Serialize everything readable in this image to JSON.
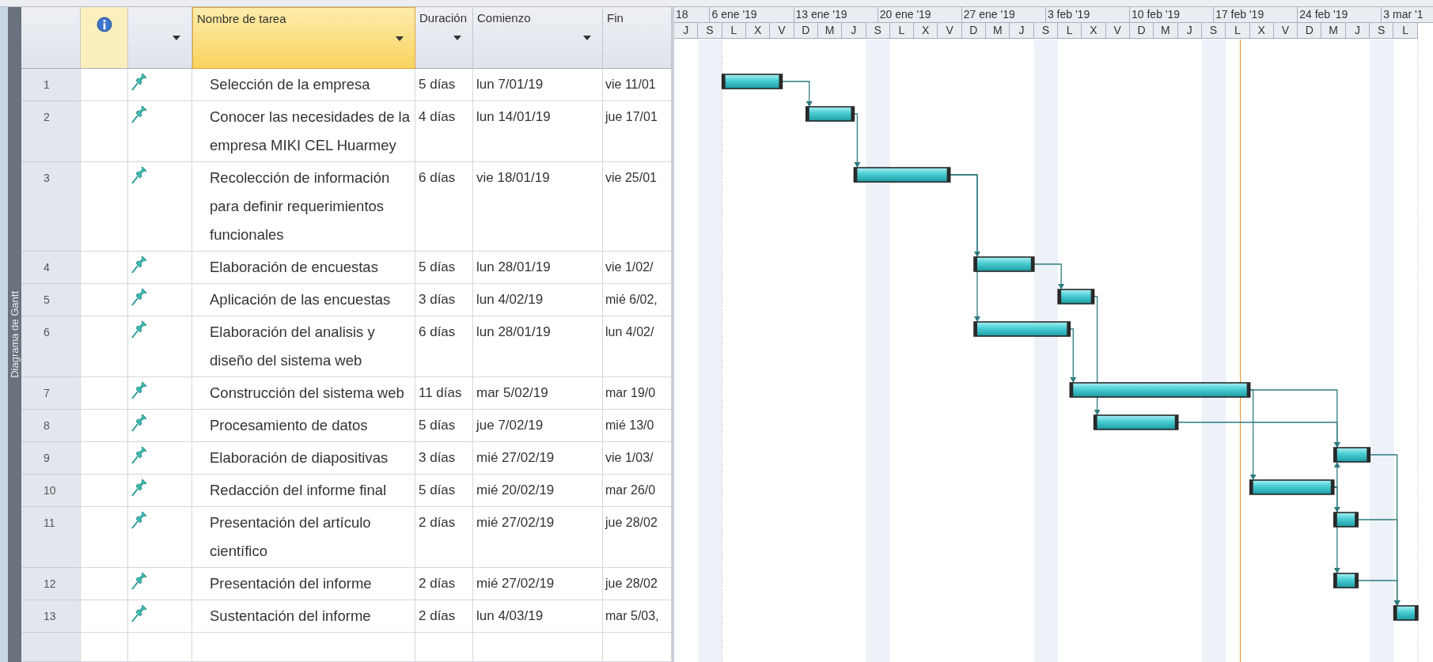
{
  "view_bar": {
    "label": "Diagrama de Gantt"
  },
  "columns": [
    {
      "kind": "info",
      "dropdown": false,
      "selected": false
    },
    {
      "kind": "indicators",
      "dropdown": true,
      "selected": false
    },
    {
      "kind": "text",
      "label": "Nombre de tarea",
      "dropdown": true,
      "selected": true
    },
    {
      "kind": "text",
      "label": "Duración",
      "dropdown": true,
      "selected": false
    },
    {
      "kind": "text",
      "label": "Comienzo",
      "dropdown": true,
      "selected": false
    },
    {
      "kind": "text",
      "label": "Fin",
      "dropdown": false,
      "selected": false
    }
  ],
  "timeline": {
    "weeks": [
      "18",
      "6 ene '19",
      "13 ene '19",
      "20 ene '19",
      "27 ene '19",
      "3 feb '19",
      "10 feb '19",
      "17 feb '19",
      "24 feb '19",
      "3 mar '1"
    ],
    "days": [
      "J",
      "S",
      "L",
      "X",
      "V",
      "D",
      "M",
      "J",
      "S",
      "L",
      "X",
      "V",
      "D",
      "M",
      "J",
      "S",
      "L",
      "X",
      "V",
      "D",
      "M",
      "J",
      "S",
      "L",
      "X",
      "V",
      "D",
      "M",
      "J",
      "S",
      "L"
    ]
  },
  "tasks": [
    {
      "id": "1",
      "name": "Selección de la empresa",
      "duration": "5 días",
      "start": "lun 7/01/19",
      "finish": "vie 11/01"
    },
    {
      "id": "2",
      "name": "Conocer las necesidades de la empresa MIKI CEL Huarmey",
      "duration": "4 días",
      "start": "lun 14/01/19",
      "finish": "jue 17/01"
    },
    {
      "id": "3",
      "name": "Recolección de información para definir requerimientos funcionales",
      "duration": "6 días",
      "start": "vie 18/01/19",
      "finish": "vie 25/01"
    },
    {
      "id": "4",
      "name": "Elaboración de encuestas",
      "duration": "5 días",
      "start": "lun 28/01/19",
      "finish": "vie 1/02/"
    },
    {
      "id": "5",
      "name": "Aplicación de las encuestas",
      "duration": "3 días",
      "start": "lun 4/02/19",
      "finish": "mié 6/02,"
    },
    {
      "id": "6",
      "name": "Elaboración del analisis y diseño del sistema web",
      "duration": "6 días",
      "start": "lun 28/01/19",
      "finish": "lun 4/02/"
    },
    {
      "id": "7",
      "name": "Construcción del sistema web",
      "duration": "11 días",
      "start": "mar 5/02/19",
      "finish": "mar 19/0"
    },
    {
      "id": "8",
      "name": "Procesamiento de datos",
      "duration": "5 días",
      "start": "jue 7/02/19",
      "finish": "mié 13/0"
    },
    {
      "id": "9",
      "name": "Elaboración de diapositivas",
      "duration": "3 días",
      "start": "mié 27/02/19",
      "finish": "vie 1/03/"
    },
    {
      "id": "10",
      "name": "Redacción del informe final",
      "duration": "5 días",
      "start": "mié 20/02/19",
      "finish": "mar 26/0"
    },
    {
      "id": "11",
      "name": "Presentación del artículo científico",
      "duration": "2 días",
      "start": "mié 27/02/19",
      "finish": "jue 28/02"
    },
    {
      "id": "12",
      "name": "Presentación del informe",
      "duration": "2 días",
      "start": "mié 27/02/19",
      "finish": "jue 28/02"
    },
    {
      "id": "13",
      "name": "Sustentación del informe",
      "duration": "2 días",
      "start": "lun 4/03/19",
      "finish": "mar 5/03,"
    }
  ]
}
